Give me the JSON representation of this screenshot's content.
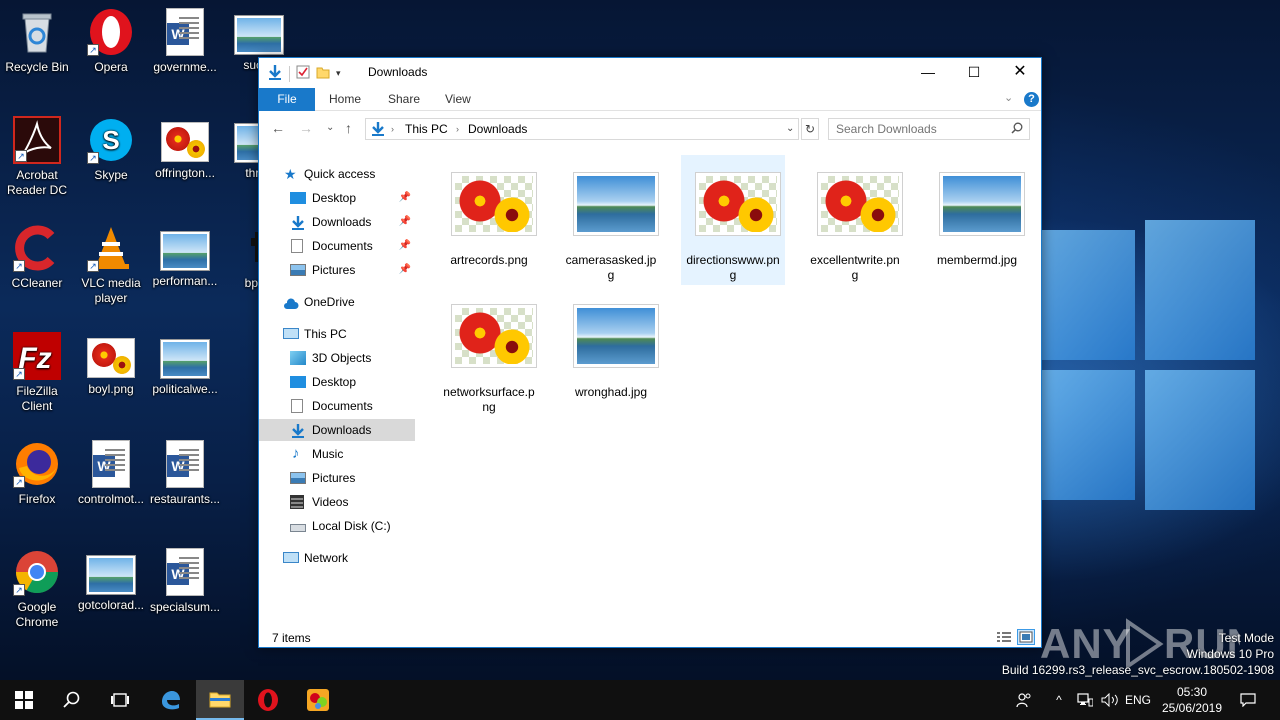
{
  "desktop": {
    "icons": [
      {
        "label": "Recycle Bin"
      },
      {
        "label": "Opera"
      },
      {
        "label": "governme..."
      },
      {
        "label": "succe"
      },
      {
        "label": "Acrobat Reader DC"
      },
      {
        "label": "Skype"
      },
      {
        "label": "offrington..."
      },
      {
        "label": "throu"
      },
      {
        "label": "CCleaner"
      },
      {
        "label": "VLC media player"
      },
      {
        "label": "performan..."
      },
      {
        "label": "bpvpl"
      },
      {
        "label": "FileZilla Client"
      },
      {
        "label": "boyl.png"
      },
      {
        "label": "politicalwe..."
      },
      {
        "label": "Firefox"
      },
      {
        "label": "controlmot..."
      },
      {
        "label": "restaurants..."
      },
      {
        "label": "Google Chrome"
      },
      {
        "label": "gotcolorad..."
      },
      {
        "label": "specialsum..."
      }
    ]
  },
  "explorer": {
    "title": "Downloads",
    "tabs": [
      "File",
      "Home",
      "Share",
      "View"
    ],
    "address": {
      "segment1": "This PC",
      "segment2": "Downloads"
    },
    "search_placeholder": "Search Downloads",
    "nav": [
      {
        "label": "Quick access"
      },
      {
        "label": "Desktop"
      },
      {
        "label": "Downloads"
      },
      {
        "label": "Documents"
      },
      {
        "label": "Pictures"
      },
      {
        "label": "OneDrive"
      },
      {
        "label": "This PC"
      },
      {
        "label": "3D Objects"
      },
      {
        "label": "Desktop"
      },
      {
        "label": "Documents"
      },
      {
        "label": "Downloads"
      },
      {
        "label": "Music"
      },
      {
        "label": "Pictures"
      },
      {
        "label": "Videos"
      },
      {
        "label": "Local Disk (C:)"
      },
      {
        "label": "Network"
      }
    ],
    "files": [
      {
        "name": "artrecords.png",
        "kind": "flower"
      },
      {
        "name": "camerasasked.jpg",
        "kind": "landscape"
      },
      {
        "name": "directionswww.png",
        "kind": "flower"
      },
      {
        "name": "excellentwrite.png",
        "kind": "flower"
      },
      {
        "name": "membermd.jpg",
        "kind": "landscape"
      },
      {
        "name": "networksurface.png",
        "kind": "flower"
      },
      {
        "name": "wronghad.jpg",
        "kind": "landscape"
      }
    ],
    "status": "7 items"
  },
  "taskbar": {
    "language": "ENG",
    "time": "05:30",
    "date": "25/06/2019"
  },
  "watermark": {
    "line1": "Test Mode",
    "line2": "Windows 10 Pro",
    "line3": "Build 16299.rs3_release_svc_escrow.180502-1908",
    "brand": "ANY RUN"
  },
  "colors": {
    "accent": "#1979ca",
    "selection": "#e5f3ff",
    "taskbar": "#101010"
  }
}
